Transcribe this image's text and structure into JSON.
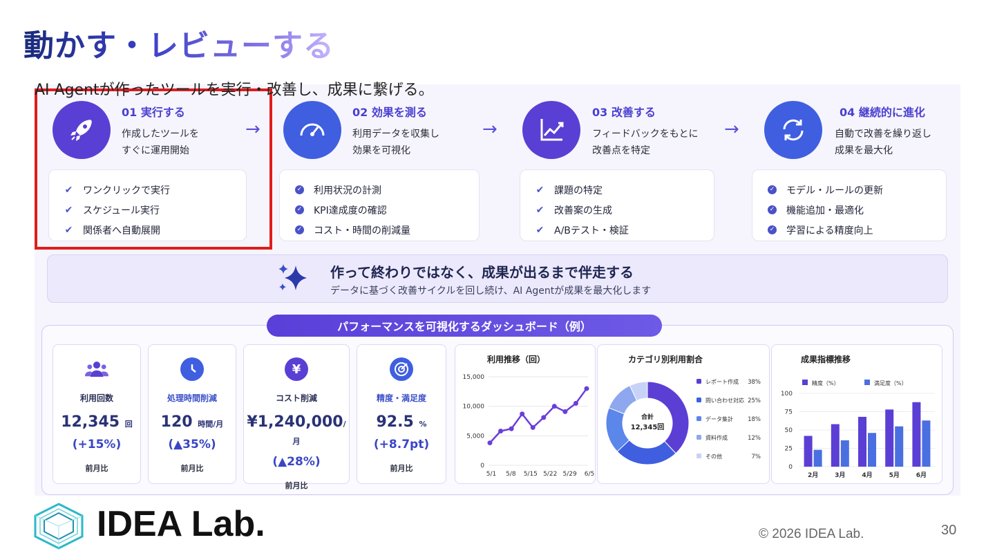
{
  "slide": {
    "title": "動かす・レビューする",
    "subtitle": "AI Agentが作ったツールを実行・改善し、成果に繋げる。",
    "copyright": "© 2026 IDEA Lab.",
    "page_number": "30",
    "logo_text": "IDEA Lab."
  },
  "steps": [
    {
      "title": "01 実行する",
      "desc": [
        "作成したツールを",
        "すぐに運用開始"
      ],
      "icon": "rocket-icon",
      "checks": [
        "ワンクリックで実行",
        "スケジュール実行",
        "関係者へ自動展開"
      ]
    },
    {
      "title": "02 効果を測る",
      "desc": [
        "利用データを収集し",
        "効果を可視化"
      ],
      "icon": "speedometer-icon",
      "checks": [
        "利用状況の計測",
        "KPI達成度の確認",
        "コスト・時間の削減量"
      ]
    },
    {
      "title": "03 改善する",
      "desc": [
        "フィードバックをもとに",
        "改善点を特定"
      ],
      "icon": "growth-chart-icon",
      "checks": [
        "課題の特定",
        "改善案の生成",
        "A/Bテスト・検証"
      ]
    },
    {
      "title": "04 継続的に進化",
      "desc": [
        "自動で改善を繰り返し",
        "成果を最大化"
      ],
      "icon": "refresh-icon",
      "checks": [
        "モデル・ルールの更新",
        "機能追加・最適化",
        "学習による精度向上"
      ]
    }
  ],
  "banner": {
    "title": "作って終わりではなく、成果が出るまで伴走する",
    "sub": "データに基づく改善サイクルを回し続け、AI Agentが成果を最大化します",
    "icon": "sparkle-icon"
  },
  "dashboard": {
    "label": "パフォーマンスを可視化するダッシュボード（例）",
    "metrics": [
      {
        "label": "利用回数",
        "value": "12,345",
        "unit": "回",
        "change": "(+15%)",
        "note": "前月比",
        "icon": "users-icon"
      },
      {
        "label": "処理時間削減",
        "value": "120",
        "unit": "時間/月",
        "change": "(▲35%)",
        "note": "前月比",
        "icon": "clock-icon"
      },
      {
        "label": "コスト削減",
        "value": "¥1,240,000",
        "unit": "/月",
        "change": "(▲28%)",
        "note": "前月比",
        "icon": "yen-icon"
      },
      {
        "label": "精度・満足度",
        "value": "92.5",
        "unit": "%",
        "change": "(+8.7pt)",
        "note": "前月比",
        "icon": "target-icon"
      }
    ]
  },
  "colors": {
    "accent": "#4a3fd0",
    "highlight": "#e01c1c",
    "bar_a": "#5b3fd4",
    "bar_b": "#4a6fe0"
  },
  "chart_data": [
    {
      "type": "line",
      "title": "利用推移（回）",
      "x_ticks": [
        "5/1",
        "5/8",
        "5/15",
        "5/22",
        "5/29",
        "6/5"
      ],
      "series": [
        {
          "values": [
            3800,
            5800,
            6200,
            8700,
            6400,
            8100,
            10000,
            9100,
            10500,
            13000
          ]
        }
      ],
      "y_ticks": [
        "0",
        "5,000",
        "10,000",
        "15,000"
      ],
      "ylim": [
        0,
        15000
      ],
      "grid": true
    },
    {
      "type": "pie",
      "title": "カテゴリ別利用割合",
      "center_label": [
        "合計",
        "12,345回"
      ],
      "slices": [
        {
          "name": "レポート作成",
          "value": 38,
          "label": "38%",
          "color": "#5b3fd4"
        },
        {
          "name": "問い合わせ対応",
          "value": 25,
          "label": "25%",
          "color": "#3f5fe0"
        },
        {
          "name": "データ集計",
          "value": 18,
          "label": "18%",
          "color": "#5b86ea"
        },
        {
          "name": "資料作成",
          "value": 12,
          "label": "12%",
          "color": "#8ea7ef"
        },
        {
          "name": "その他",
          "value": 7,
          "label": "7%",
          "color": "#c7d3f6"
        }
      ],
      "legend": "right"
    },
    {
      "type": "bar",
      "title": "成果指標推移",
      "categories": [
        "2月",
        "3月",
        "4月",
        "5月",
        "6月"
      ],
      "series": [
        {
          "name": "精度（%）",
          "values": [
            42,
            58,
            68,
            78,
            88
          ]
        },
        {
          "name": "満足度（%）",
          "values": [
            23,
            36,
            46,
            55,
            63
          ]
        }
      ],
      "y_ticks": [
        "0",
        "25",
        "50",
        "75",
        "100"
      ],
      "ylim": [
        0,
        100
      ],
      "legend": "top-left"
    }
  ]
}
